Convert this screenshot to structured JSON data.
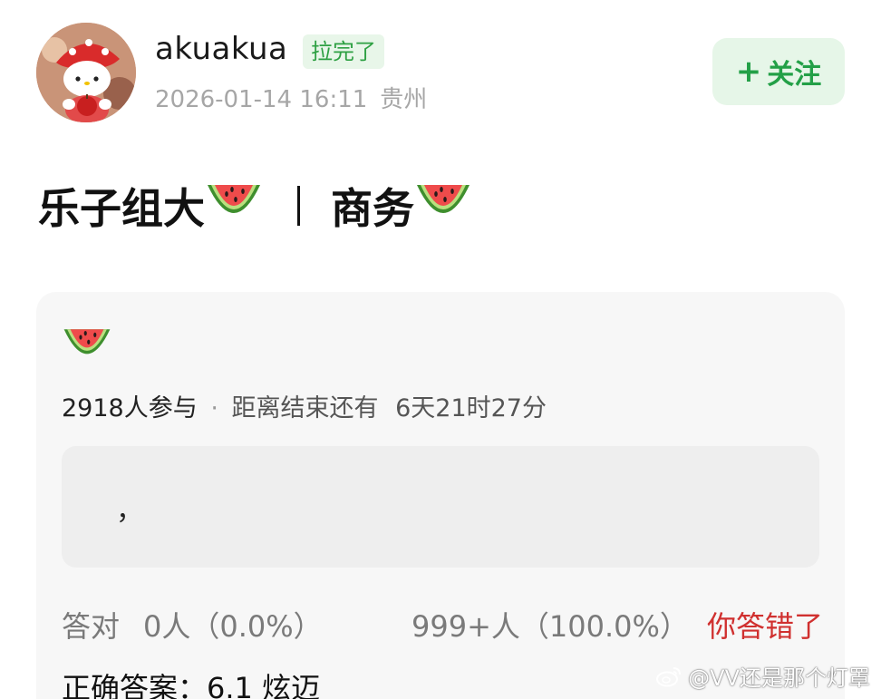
{
  "header": {
    "username": "akuakua",
    "status_badge": "拉完了",
    "timestamp": "2026-01-14 16:11",
    "location": "贵州",
    "follow_label": "关注",
    "follow_plus": "+"
  },
  "title": {
    "part1": "乐子组大",
    "part2": "商务",
    "emoji_icon": "watermelon-icon"
  },
  "poll": {
    "participants": "2918人参与",
    "separator": "·",
    "countdown_label": "距离结束还有",
    "countdown_value": "6天21时27分",
    "option_text": "，",
    "result_label": "答对",
    "correct_count": "0人（0.0%）",
    "wrong_count": "999+人（100.0%）",
    "verdict": "你答错了",
    "answer": "正确答案：6.1 炫迈"
  },
  "watermark": {
    "text": "@VV还是那个灯罩",
    "icon": "weibo-logo-icon"
  },
  "colors": {
    "accent_green": "#23a047",
    "badge_bg": "#e8f6e9",
    "error_red": "#d0302f",
    "card_bg": "#f7f7f7",
    "meta_gray": "#a6a6a6"
  }
}
